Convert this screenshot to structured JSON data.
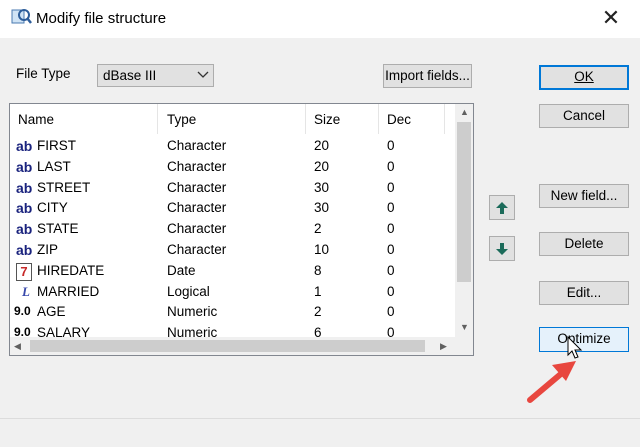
{
  "window": {
    "title": "Modify file structure"
  },
  "file_type": {
    "label": "File Type",
    "value": "dBase III"
  },
  "buttons": {
    "import": "Import fields...",
    "ok": "OK",
    "cancel": "Cancel",
    "new_field": "New field...",
    "delete": "Delete",
    "edit": "Edit...",
    "optimize": "Optimize"
  },
  "columns": [
    "Name",
    "Type",
    "Size",
    "Dec"
  ],
  "rows": [
    {
      "icon": "ab",
      "name": "FIRST",
      "type": "Character",
      "size": "20",
      "dec": "0"
    },
    {
      "icon": "ab",
      "name": "LAST",
      "type": "Character",
      "size": "20",
      "dec": "0"
    },
    {
      "icon": "ab",
      "name": "STREET",
      "type": "Character",
      "size": "30",
      "dec": "0"
    },
    {
      "icon": "ab",
      "name": "CITY",
      "type": "Character",
      "size": "30",
      "dec": "0"
    },
    {
      "icon": "ab",
      "name": "STATE",
      "type": "Character",
      "size": "2",
      "dec": "0"
    },
    {
      "icon": "ab",
      "name": "ZIP",
      "type": "Character",
      "size": "10",
      "dec": "0"
    },
    {
      "icon": "7",
      "name": "HIREDATE",
      "type": "Date",
      "size": "8",
      "dec": "0"
    },
    {
      "icon": "L",
      "name": "MARRIED",
      "type": "Logical",
      "size": "1",
      "dec": "0"
    },
    {
      "icon": "9.0",
      "name": "AGE",
      "type": "Numeric",
      "size": "2",
      "dec": "0"
    },
    {
      "icon": "9.0",
      "name": "SALARY",
      "type": "Numeric",
      "size": "6",
      "dec": "0"
    }
  ],
  "icon_names": {
    "ab": "character-field-icon",
    "7": "date-field-icon",
    "L": "logical-field-icon",
    "9.0": "numeric-field-icon"
  },
  "colors": {
    "accent": "#0078d7",
    "annotation_arrow": "#e8473f",
    "char_icon": "#1a237e"
  }
}
